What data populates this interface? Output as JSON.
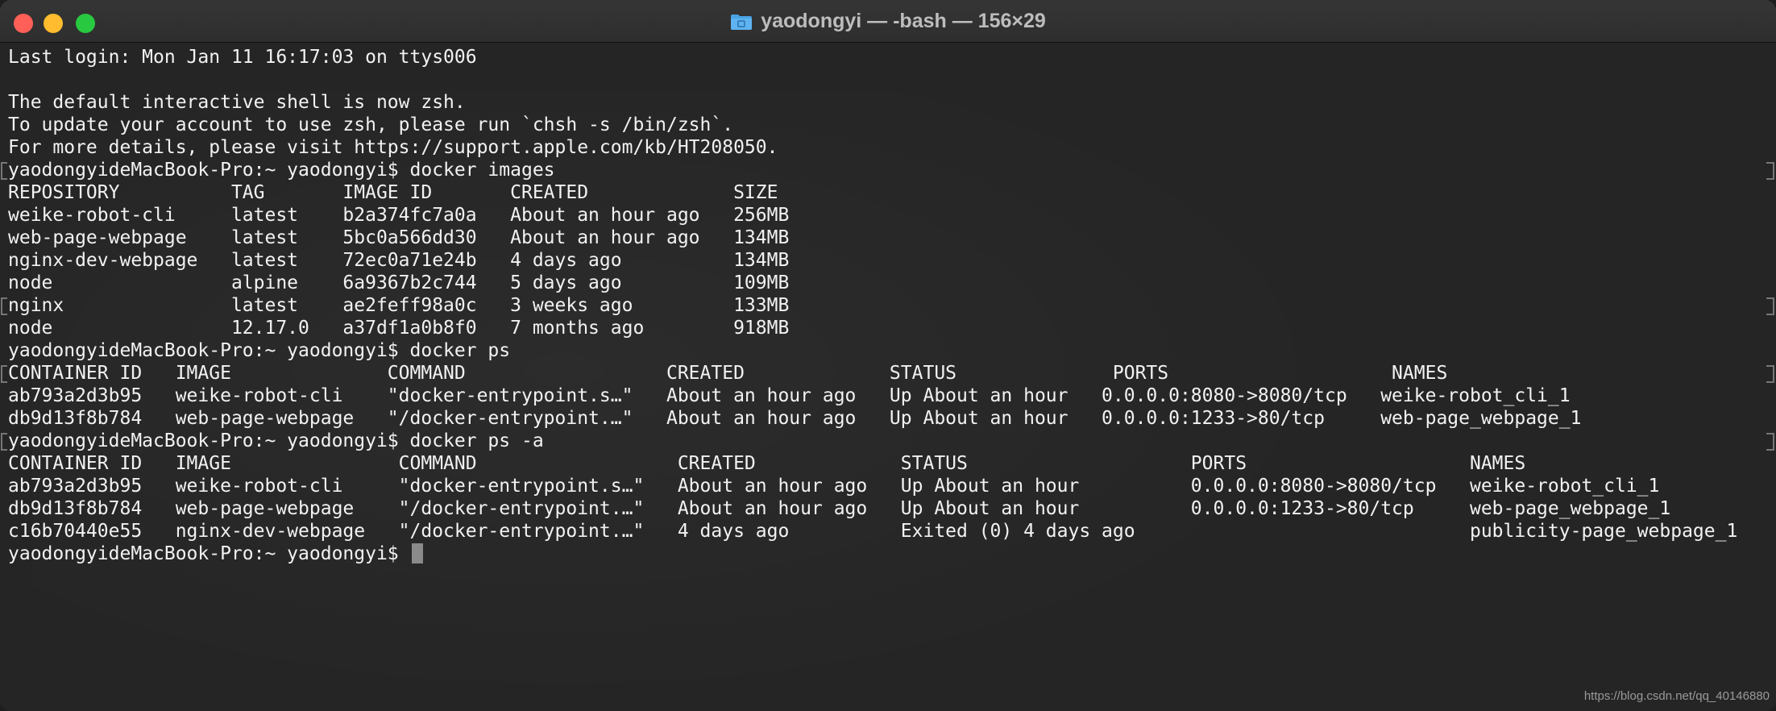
{
  "window": {
    "title": "yaodongyi — -bash — 156×29"
  },
  "terminal": {
    "lines": [
      "Last login: Mon Jan 11 16:17:03 on ttys006",
      "",
      "The default interactive shell is now zsh.",
      "To update your account to use zsh, please run `chsh -s /bin/zsh`.",
      "For more details, please visit https://support.apple.com/kb/HT208050.",
      "yaodongyideMacBook-Pro:~ yaodongyi$ docker images",
      "REPOSITORY          TAG       IMAGE ID       CREATED             SIZE",
      "weike-robot-cli     latest    b2a374fc7a0a   About an hour ago   256MB",
      "web-page-webpage    latest    5bc0a566dd30   About an hour ago   134MB",
      "nginx-dev-webpage   latest    72ec0a71e24b   4 days ago          134MB",
      "node                alpine    6a9367b2c744   5 days ago          109MB",
      "nginx               latest    ae2feff98a0c   3 weeks ago         133MB",
      "node                12.17.0   a37df1a0b8f0   7 months ago        918MB",
      "yaodongyideMacBook-Pro:~ yaodongyi$ docker ps",
      "CONTAINER ID   IMAGE              COMMAND                  CREATED             STATUS              PORTS                    NAMES",
      "ab793a2d3b95   weike-robot-cli    \"docker-entrypoint.s…\"   About an hour ago   Up About an hour   0.0.0.0:8080->8080/tcp   weike-robot_cli_1",
      "db9d13f8b784   web-page-webpage   \"/docker-entrypoint.…\"   About an hour ago   Up About an hour   0.0.0.0:1233->80/tcp     web-page_webpage_1",
      "yaodongyideMacBook-Pro:~ yaodongyi$ docker ps -a",
      "CONTAINER ID   IMAGE               COMMAND                  CREATED             STATUS                    PORTS                    NAMES",
      "ab793a2d3b95   weike-robot-cli     \"docker-entrypoint.s…\"   About an hour ago   Up About an hour          0.0.0.0:8080->8080/tcp   weike-robot_cli_1",
      "db9d13f8b784   web-page-webpage    \"/docker-entrypoint.…\"   About an hour ago   Up About an hour          0.0.0.0:1233->80/tcp     web-page_webpage_1",
      "c16b70440e55   nginx-dev-webpage   \"/docker-entrypoint.…\"   4 days ago          Exited (0) 4 days ago                              publicity-page_webpage_1"
    ],
    "prompt": "yaodongyideMacBook-Pro:~ yaodongyi$ "
  },
  "watermark": "https://blog.csdn.net/qq_40146880",
  "colors": {
    "background": "#252525",
    "text": "#f2f2f2",
    "close": "#fe5f57",
    "minimize": "#febc2e",
    "zoom": "#28c840"
  },
  "icons": {
    "title_icon": "folder-icon",
    "close": "close-button",
    "minimize": "minimize-button",
    "zoom": "zoom-button"
  }
}
